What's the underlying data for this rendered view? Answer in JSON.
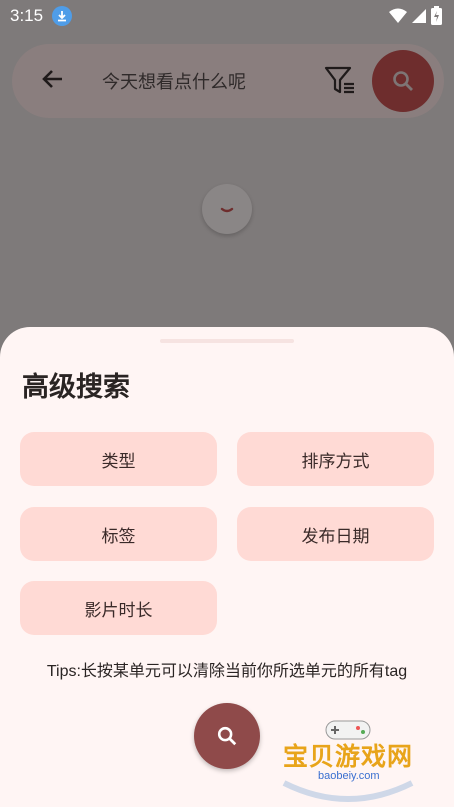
{
  "status_bar": {
    "time": "3:15"
  },
  "search": {
    "placeholder": "今天想看点什么呢",
    "back_icon": "arrow-left-icon",
    "filter_icon": "filter-icon",
    "search_icon": "search-icon"
  },
  "sheet": {
    "title": "高级搜索",
    "chips": [
      "类型",
      "排序方式",
      "标签",
      "发布日期",
      "影片时长"
    ],
    "tips": "Tips:长按某单元可以清除当前你所选单元的所有tag"
  },
  "watermark": {
    "name": "宝贝游戏网",
    "url": "baobeiy.com"
  },
  "colors": {
    "accent": "#8f4a4a",
    "chip_bg": "#ffdad5",
    "sheet_bg": "#fff5f4"
  }
}
